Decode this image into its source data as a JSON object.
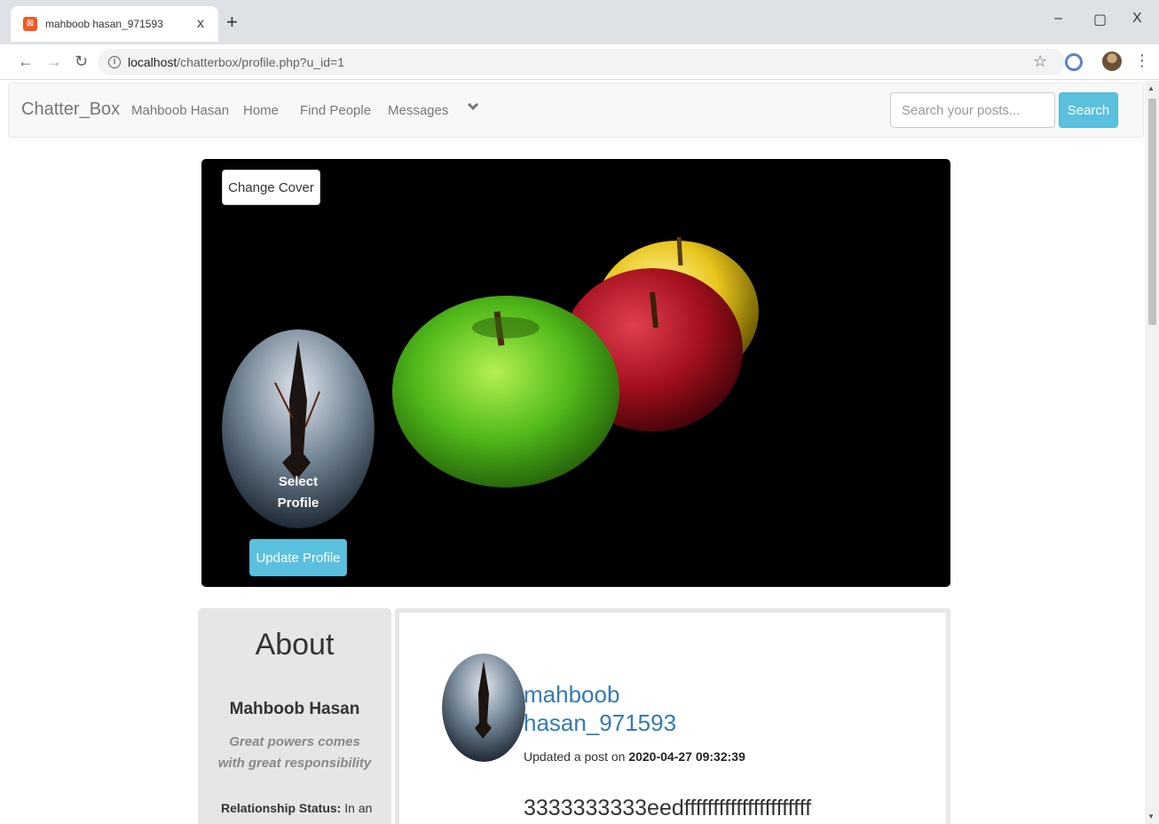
{
  "browser": {
    "tab_title": "mahboob hasan_971593",
    "tab_close": "x",
    "new_tab": "+",
    "url_host": "localhost",
    "url_path": "/chatterbox/profile.php?u_id=1",
    "window_controls": {
      "minimize": "–",
      "restore": "▢",
      "close": "X"
    }
  },
  "navbar": {
    "brand": "Chatter_Box",
    "links": [
      "Mahboob Hasan",
      "Home",
      "Find People",
      "Messages"
    ],
    "caret": "❯",
    "search_placeholder": "Search your posts...",
    "search_button": "Search"
  },
  "cover": {
    "change_cover_label": "Change Cover",
    "select_profile_line1": "Select",
    "select_profile_line2": "Profile",
    "update_profile_label": "Update Profile"
  },
  "about": {
    "heading": "About",
    "name": "Mahboob Hasan",
    "quote": "Great powers comes with great responsibility",
    "relationship_label": "Relationship Status:",
    "relationship_value": "In an"
  },
  "post": {
    "username_line1": "mahboob",
    "username_line2": "hasan_971593",
    "meta_prefix": "Updated a post on",
    "timestamp": "2020-04-27 09:32:39",
    "content": "3333333333eedffffffffffffffffffffff"
  },
  "icons": {
    "favicon": "xampp-icon",
    "info": "info-icon",
    "star": "star-icon",
    "caret": "chevron-down-icon"
  },
  "colors": {
    "accent": "#5bc0de",
    "link": "#337ab7",
    "navbar_bg": "#f8f8f8",
    "about_bg": "#e6e6e6"
  }
}
